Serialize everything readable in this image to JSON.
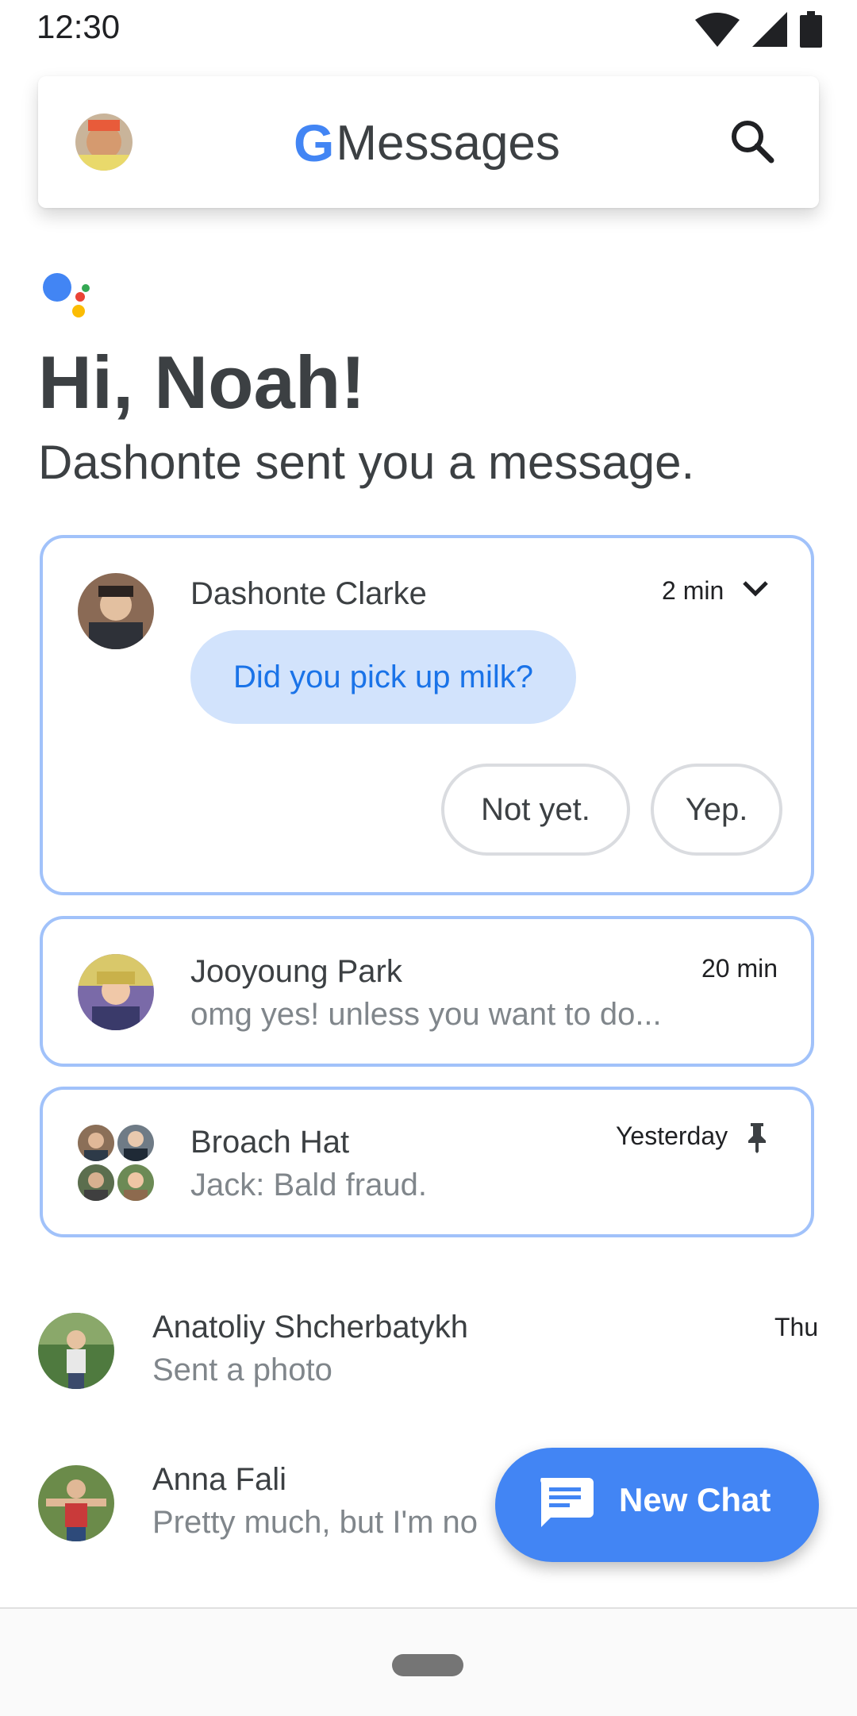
{
  "status_bar": {
    "time": "12:30"
  },
  "app_bar": {
    "logo_letter": "G",
    "title": "Messages"
  },
  "assistant": {
    "greeting": "Hi, Noah!",
    "subtitle": "Dashonte sent you a message."
  },
  "featured": {
    "name": "Dashonte Clarke",
    "time": "2 min",
    "message": "Did you pick up milk?",
    "replies": [
      "Not yet.",
      "Yep."
    ]
  },
  "conversations": [
    {
      "name": "Jooyoung Park",
      "time": "20 min",
      "snippet": "omg yes! unless you want to do..."
    },
    {
      "name": "Broach Hat",
      "time": "Yesterday",
      "snippet": "Jack: Bald fraud.",
      "pinned": true
    },
    {
      "name": "Anatoliy Shcherbatykh",
      "time": "Thu",
      "snippet": "Sent a photo"
    },
    {
      "name": "Anna Fali",
      "time": "",
      "snippet": "Pretty much, but I'm no"
    }
  ],
  "fab": {
    "label": "New Chat"
  },
  "colors": {
    "accent": "#4285f4",
    "card_border": "#a1c2fa",
    "bubble": "#d2e3fc",
    "bubble_text": "#1a73e8"
  }
}
